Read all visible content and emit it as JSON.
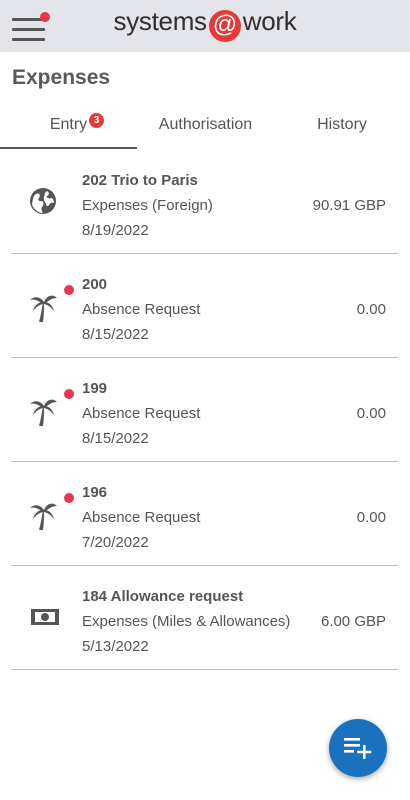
{
  "app": {
    "logo_left": "systems",
    "logo_at": "@",
    "logo_right": "work"
  },
  "page": {
    "title": "Expenses"
  },
  "tabs": [
    {
      "label": "Entry",
      "badge": "3",
      "selected": true
    },
    {
      "label": "Authorisation",
      "selected": false
    },
    {
      "label": "History",
      "selected": false
    }
  ],
  "items": [
    {
      "title": "202 Trio to Paris",
      "subtitle": "Expenses (Foreign)",
      "date": "8/19/2022",
      "amount": "90.91 GBP",
      "icon": "globe-icon",
      "unread": false
    },
    {
      "title": "200",
      "subtitle": "Absence Request",
      "date": "8/15/2022",
      "amount": "0.00",
      "icon": "palm-tree-icon",
      "unread": true
    },
    {
      "title": "199",
      "subtitle": "Absence Request",
      "date": "8/15/2022",
      "amount": "0.00",
      "icon": "palm-tree-icon",
      "unread": true
    },
    {
      "title": "196",
      "subtitle": "Absence Request",
      "date": "7/20/2022",
      "amount": "0.00",
      "icon": "palm-tree-icon",
      "unread": true
    },
    {
      "title": "184 Allowance request",
      "subtitle": "Expenses (Miles & Allowances)",
      "date": "5/13/2022",
      "amount": "6.00 GBP",
      "icon": "cash-icon",
      "unread": false
    }
  ],
  "fab": {
    "icon": "add-list-icon"
  },
  "colors": {
    "topbar": "#e3e5ea",
    "accent_red": "#e43a3a",
    "fab_blue": "#1a72be"
  }
}
